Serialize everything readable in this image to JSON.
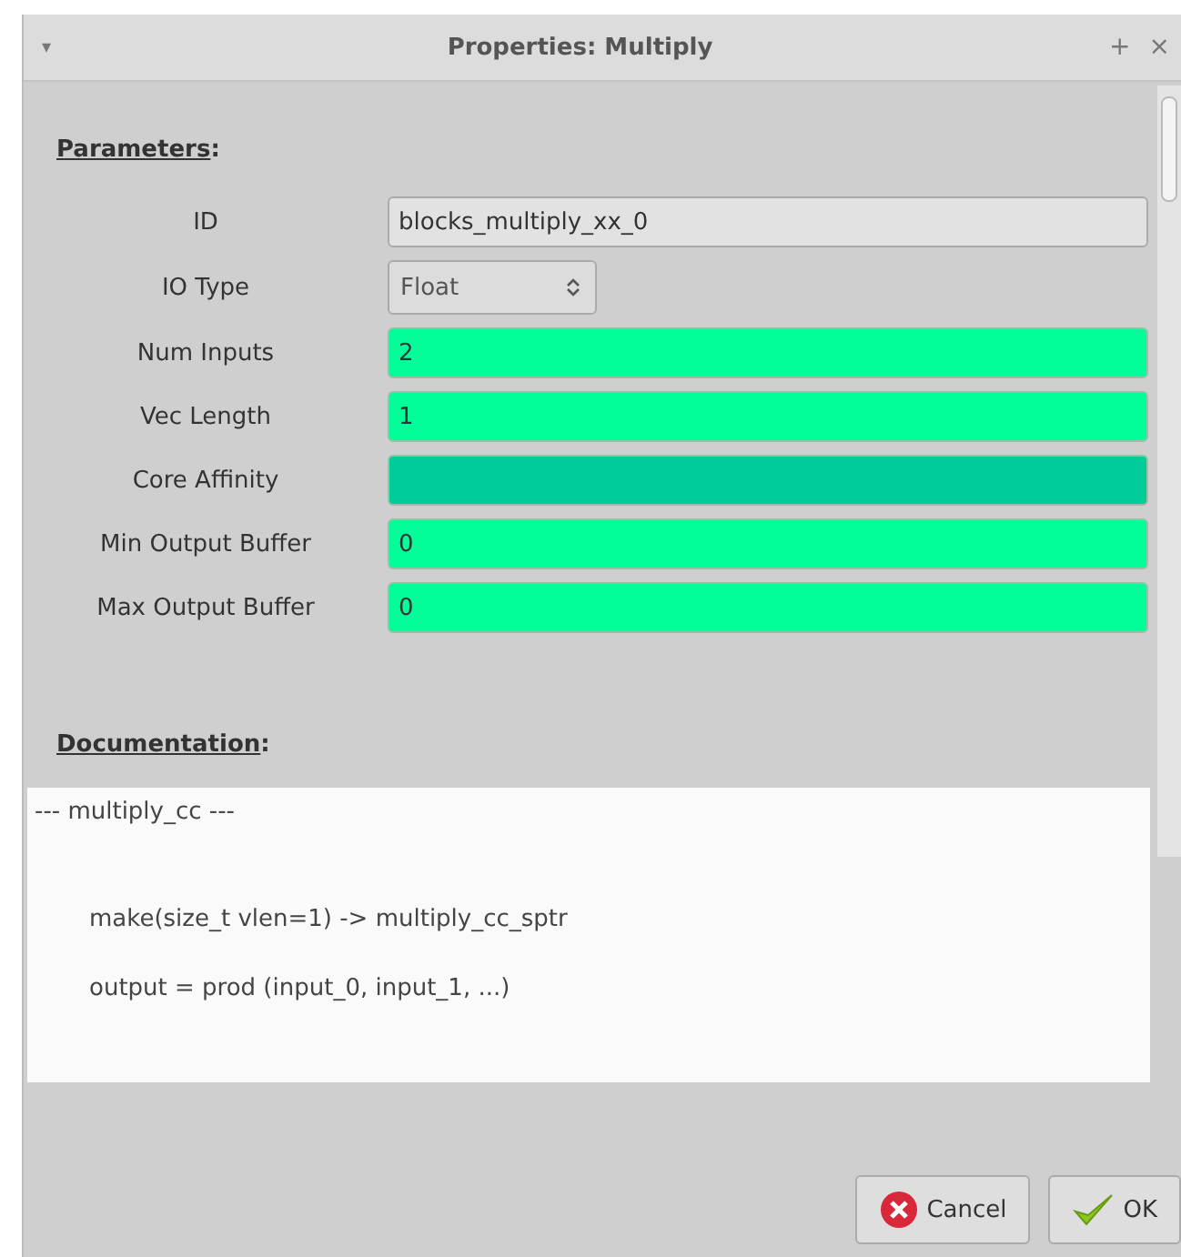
{
  "window": {
    "title": "Properties: Multiply",
    "menu_glyph": "▾",
    "pin_glyph": "+",
    "close_glyph": "×"
  },
  "parameters": {
    "heading": "Parameters:",
    "rows": [
      {
        "label": "ID",
        "kind": "text",
        "value": "blocks_multiply_xx_0",
        "color": "#e2e2e2"
      },
      {
        "label": "IO Type",
        "kind": "select",
        "value": "Float",
        "color": "#dcdcdc"
      },
      {
        "label": "Num Inputs",
        "kind": "text",
        "value": "2",
        "color": "#00ff99"
      },
      {
        "label": "Vec Length",
        "kind": "text",
        "value": "1",
        "color": "#00ff99"
      },
      {
        "label": "Core Affinity",
        "kind": "text",
        "value": "",
        "color": "#00cc99"
      },
      {
        "label": "Min Output Buffer",
        "kind": "text",
        "value": "0",
        "color": "#00ff99"
      },
      {
        "label": "Max Output Buffer",
        "kind": "text",
        "value": "0",
        "color": "#00ff99"
      }
    ]
  },
  "documentation": {
    "heading": "Documentation:",
    "lines": [
      "---  multiply_cc  ---",
      "make(size_t vlen=1) -> multiply_cc_sptr",
      "output = prod (input_0, input_1, ...)"
    ]
  },
  "buttons": [
    {
      "label": "Cancel",
      "kind": "cancel"
    },
    {
      "label": "OK",
      "kind": "ok"
    }
  ]
}
